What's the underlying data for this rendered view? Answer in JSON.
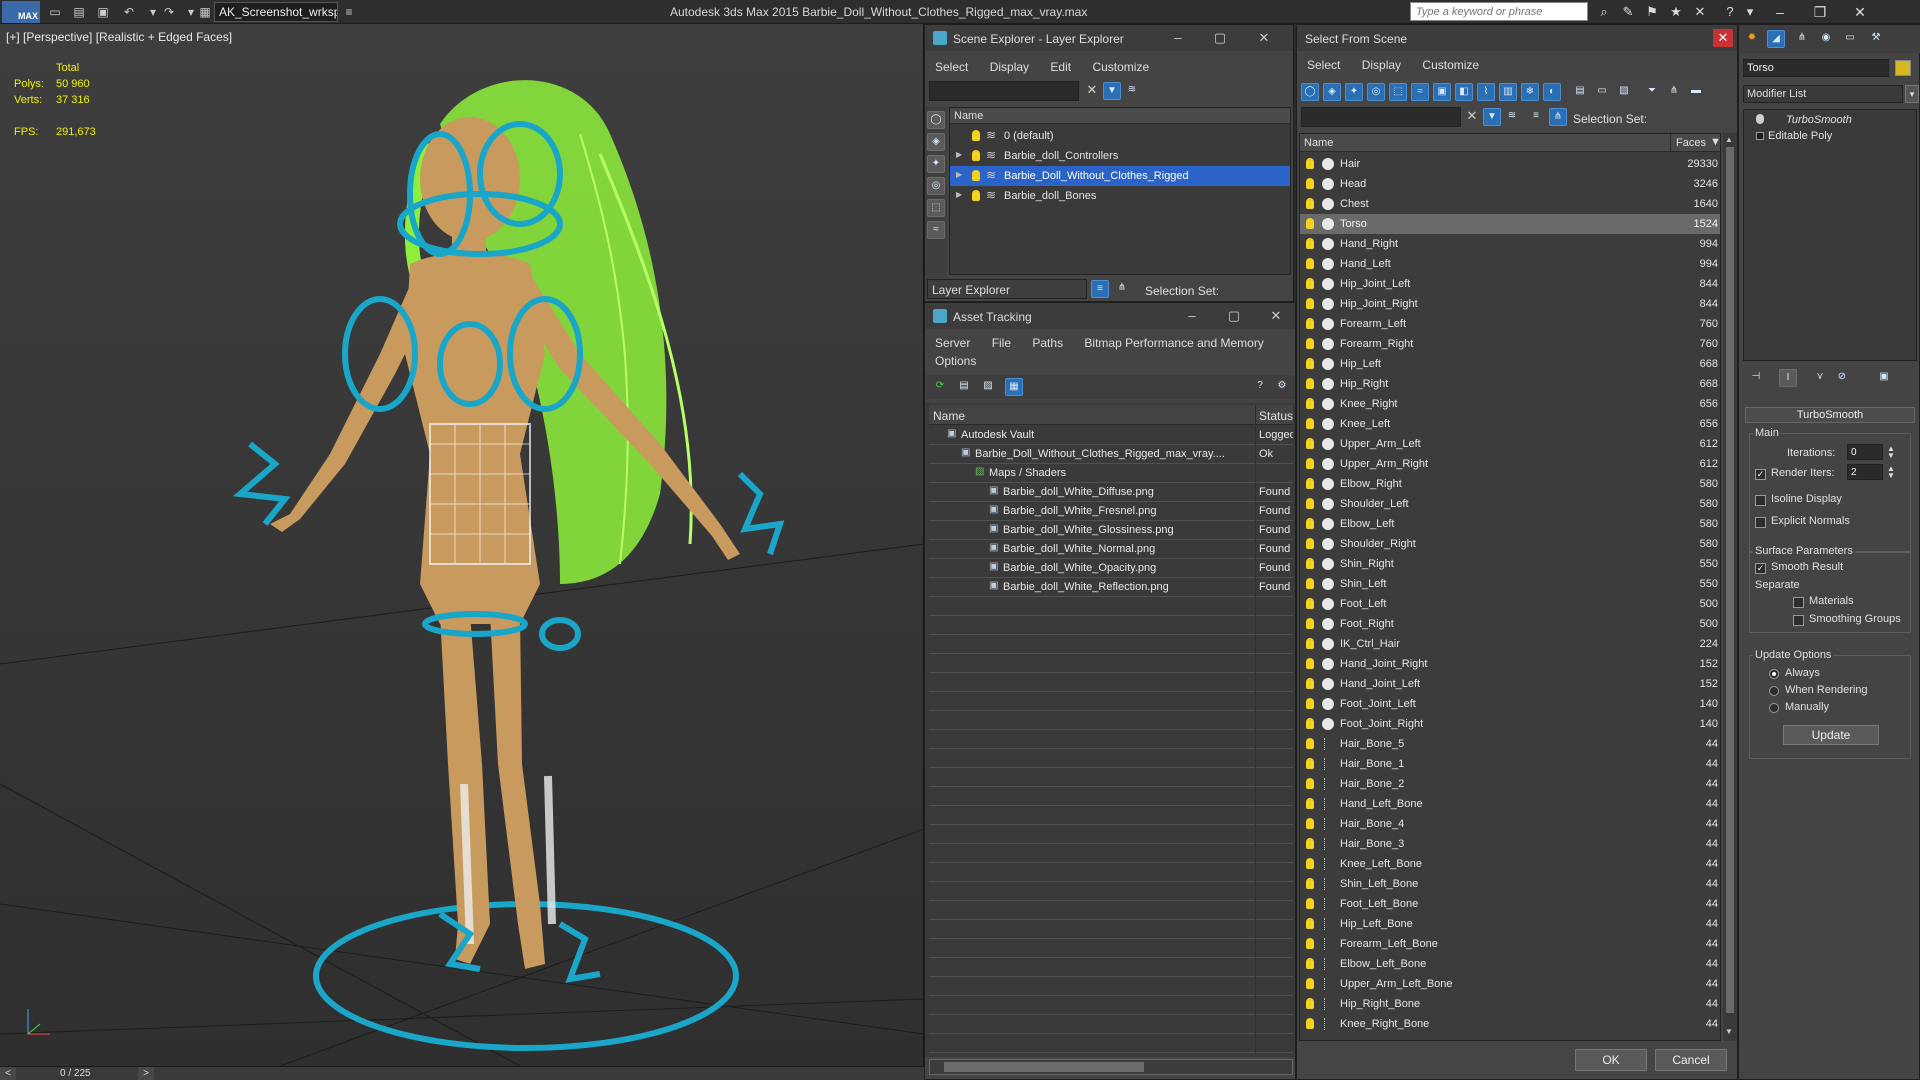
{
  "app": {
    "logo_text": "MAX",
    "workspace": "AK_Screenshot_wrksp",
    "title": "Autodesk 3ds Max  2015    Barbie_Doll_Without_Clothes_Rigged_max_vray.max",
    "search_placeholder": "Type a keyword or phrase"
  },
  "viewport": {
    "label": "[+] [Perspective] [Realistic + Edged Faces]",
    "stats_header": "Total",
    "polys_label": "Polys:",
    "polys_value": "50 960",
    "verts_label": "Verts:",
    "verts_value": "37 316",
    "fps_label": "FPS:",
    "fps_value": "291,673"
  },
  "timeline": {
    "frame": "0 / 225",
    "prev": "<",
    "next": ">"
  },
  "scene_explorer": {
    "title": "Scene Explorer - Layer Explorer",
    "menu": [
      "Select",
      "Display",
      "Edit",
      "Customize"
    ],
    "column": "Name",
    "layers": [
      {
        "name": "0 (default)",
        "expander": false,
        "selected": false
      },
      {
        "name": "Barbie_doll_Controllers",
        "expander": true,
        "selected": false
      },
      {
        "name": "Barbie_Doll_Without_Clothes_Rigged",
        "expander": true,
        "selected": true
      },
      {
        "name": "Barbie_doll_Bones",
        "expander": true,
        "selected": false
      }
    ],
    "footer_dropdown": "Layer Explorer",
    "selection_set_label": "Selection Set:"
  },
  "asset_tracking": {
    "title": "Asset Tracking",
    "menu_row1": [
      "Server",
      "File",
      "Paths",
      "Bitmap Performance and Memory"
    ],
    "menu_row2": [
      "Options"
    ],
    "col_name": "Name",
    "col_status": "Status",
    "rows": [
      {
        "name": "Autodesk Vault",
        "status": "Logged",
        "indent": 0
      },
      {
        "name": "Barbie_Doll_Without_Clothes_Rigged_max_vray....",
        "status": "Ok",
        "indent": 1
      },
      {
        "name": "Maps / Shaders",
        "status": "",
        "indent": 2
      },
      {
        "name": "Barbie_doll_White_Diffuse.png",
        "status": "Found",
        "indent": 3
      },
      {
        "name": "Barbie_doll_White_Fresnel.png",
        "status": "Found",
        "indent": 3
      },
      {
        "name": "Barbie_doll_White_Glossiness.png",
        "status": "Found",
        "indent": 3
      },
      {
        "name": "Barbie_doll_White_Normal.png",
        "status": "Found",
        "indent": 3
      },
      {
        "name": "Barbie_doll_White_Opacity.png",
        "status": "Found",
        "indent": 3
      },
      {
        "name": "Barbie_doll_White_Reflection.png",
        "status": "Found",
        "indent": 3
      }
    ]
  },
  "select_from_scene": {
    "title": "Select From Scene",
    "menu": [
      "Select",
      "Display",
      "Customize"
    ],
    "selection_set_label": "Selection Set:",
    "col_name": "Name",
    "col_faces": "Faces",
    "ok_label": "OK",
    "cancel_label": "Cancel",
    "objects": [
      {
        "name": "Hair",
        "faces": "29330",
        "bone": false,
        "selected": false
      },
      {
        "name": "Head",
        "faces": "3246",
        "bone": false,
        "selected": false
      },
      {
        "name": "Chest",
        "faces": "1640",
        "bone": false,
        "selected": false
      },
      {
        "name": "Torso",
        "faces": "1524",
        "bone": false,
        "selected": true
      },
      {
        "name": "Hand_Right",
        "faces": "994",
        "bone": false,
        "selected": false
      },
      {
        "name": "Hand_Left",
        "faces": "994",
        "bone": false,
        "selected": false
      },
      {
        "name": "Hip_Joint_Left",
        "faces": "844",
        "bone": false,
        "selected": false
      },
      {
        "name": "Hip_Joint_Right",
        "faces": "844",
        "bone": false,
        "selected": false
      },
      {
        "name": "Forearm_Left",
        "faces": "760",
        "bone": false,
        "selected": false
      },
      {
        "name": "Forearm_Right",
        "faces": "760",
        "bone": false,
        "selected": false
      },
      {
        "name": "Hip_Left",
        "faces": "668",
        "bone": false,
        "selected": false
      },
      {
        "name": "Hip_Right",
        "faces": "668",
        "bone": false,
        "selected": false
      },
      {
        "name": "Knee_Right",
        "faces": "656",
        "bone": false,
        "selected": false
      },
      {
        "name": "Knee_Left",
        "faces": "656",
        "bone": false,
        "selected": false
      },
      {
        "name": "Upper_Arm_Left",
        "faces": "612",
        "bone": false,
        "selected": false
      },
      {
        "name": "Upper_Arm_Right",
        "faces": "612",
        "bone": false,
        "selected": false
      },
      {
        "name": "Elbow_Right",
        "faces": "580",
        "bone": false,
        "selected": false
      },
      {
        "name": "Shoulder_Left",
        "faces": "580",
        "bone": false,
        "selected": false
      },
      {
        "name": "Elbow_Left",
        "faces": "580",
        "bone": false,
        "selected": false
      },
      {
        "name": "Shoulder_Right",
        "faces": "580",
        "bone": false,
        "selected": false
      },
      {
        "name": "Shin_Right",
        "faces": "550",
        "bone": false,
        "selected": false
      },
      {
        "name": "Shin_Left",
        "faces": "550",
        "bone": false,
        "selected": false
      },
      {
        "name": "Foot_Left",
        "faces": "500",
        "bone": false,
        "selected": false
      },
      {
        "name": "Foot_Right",
        "faces": "500",
        "bone": false,
        "selected": false
      },
      {
        "name": "IK_Ctrl_Hair",
        "faces": "224",
        "bone": false,
        "selected": false
      },
      {
        "name": "Hand_Joint_Right",
        "faces": "152",
        "bone": false,
        "selected": false
      },
      {
        "name": "Hand_Joint_Left",
        "faces": "152",
        "bone": false,
        "selected": false
      },
      {
        "name": "Foot_Joint_Left",
        "faces": "140",
        "bone": false,
        "selected": false
      },
      {
        "name": "Foot_Joint_Right",
        "faces": "140",
        "bone": false,
        "selected": false
      },
      {
        "name": "Hair_Bone_5",
        "faces": "44",
        "bone": true,
        "selected": false
      },
      {
        "name": "Hair_Bone_1",
        "faces": "44",
        "bone": true,
        "selected": false
      },
      {
        "name": "Hair_Bone_2",
        "faces": "44",
        "bone": true,
        "selected": false
      },
      {
        "name": "Hand_Left_Bone",
        "faces": "44",
        "bone": true,
        "selected": false
      },
      {
        "name": "Hair_Bone_4",
        "faces": "44",
        "bone": true,
        "selected": false
      },
      {
        "name": "Hair_Bone_3",
        "faces": "44",
        "bone": true,
        "selected": false
      },
      {
        "name": "Knee_Left_Bone",
        "faces": "44",
        "bone": true,
        "selected": false
      },
      {
        "name": "Shin_Left_Bone",
        "faces": "44",
        "bone": true,
        "selected": false
      },
      {
        "name": "Foot_Left_Bone",
        "faces": "44",
        "bone": true,
        "selected": false
      },
      {
        "name": "Hip_Left_Bone",
        "faces": "44",
        "bone": true,
        "selected": false
      },
      {
        "name": "Forearm_Left_Bone",
        "faces": "44",
        "bone": true,
        "selected": false
      },
      {
        "name": "Elbow_Left_Bone",
        "faces": "44",
        "bone": true,
        "selected": false
      },
      {
        "name": "Upper_Arm_Left_Bone",
        "faces": "44",
        "bone": true,
        "selected": false
      },
      {
        "name": "Hip_Right_Bone",
        "faces": "44",
        "bone": true,
        "selected": false
      },
      {
        "name": "Knee_Right_Bone",
        "faces": "44",
        "bone": true,
        "selected": false
      }
    ]
  },
  "command_panel": {
    "object_name": "Torso",
    "modifier_list": "Modifier List",
    "stack": [
      "TurboSmooth",
      "Editable Poly"
    ],
    "rollout_title": "TurboSmooth",
    "main_label": "Main",
    "iterations_label": "Iterations:",
    "iterations_value": "0",
    "render_iters_label": "Render Iters:",
    "render_iters_value": "2",
    "isoline_label": "Isoline Display",
    "explicit_normals_label": "Explicit Normals",
    "surface_params_label": "Surface Parameters",
    "smooth_result_label": "Smooth Result",
    "separate_label": "Separate",
    "materials_label": "Materials",
    "smoothing_groups_label": "Smoothing Groups",
    "update_options_label": "Update Options",
    "always_label": "Always",
    "when_rendering_label": "When Rendering",
    "manually_label": "Manually",
    "update_button": "Update"
  },
  "colors": {
    "selection_blue": "#2b63c8",
    "rig_cyan": "#1aa6c8",
    "hair_green": "#8ef03a",
    "skin": "#c89a5e",
    "bulb_yellow": "#f4d21e"
  }
}
